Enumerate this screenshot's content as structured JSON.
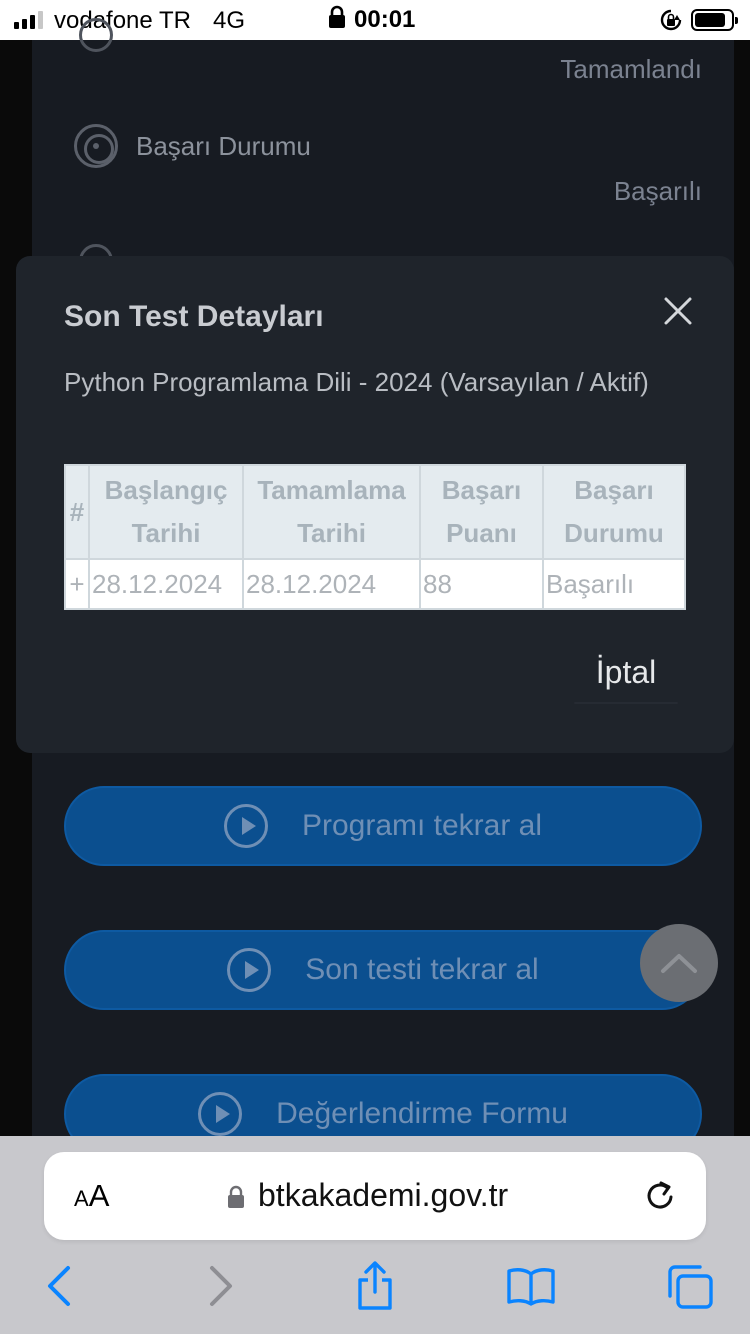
{
  "status_bar": {
    "carrier": "vodafone TR",
    "network": "4G",
    "time": "00:01",
    "battery_level": 0.85
  },
  "background": {
    "rows": [
      {
        "label": "",
        "value": "Tamamlandı"
      },
      {
        "label": "Başarı Durumu",
        "value": "Başarılı"
      }
    ],
    "buttons": [
      {
        "label": "Programı tekrar al"
      },
      {
        "label": "Son testi tekrar al"
      },
      {
        "label": "Değerlendirme Formu"
      }
    ]
  },
  "modal": {
    "title": "Son Test Detayları",
    "subtitle": "Python Programlama Dili - 2024 (Varsayılan / Aktif)",
    "table": {
      "headers": [
        "#",
        "Başlangıç Tarihi",
        "Tamamlama Tarihi",
        "Başarı Puanı",
        "Başarı Durumu"
      ],
      "rows": [
        [
          "+",
          "28.12.2024",
          "28.12.2024",
          "88",
          "Başarılı"
        ]
      ]
    },
    "cancel_label": "İptal"
  },
  "browser": {
    "text_size_small": "A",
    "text_size_large": "A",
    "url": "btkakademi.gov.tr"
  },
  "icons": {
    "close": "close-icon",
    "play": "play-circle-icon",
    "scroll_top": "chevron-up-icon",
    "back": "chevron-left-icon",
    "forward": "chevron-right-icon",
    "share": "share-icon",
    "bookmarks": "book-icon",
    "tabs": "tabs-icon"
  },
  "colors": {
    "primary_button": "#0b4f8f",
    "modal_background": "#1f242b",
    "ios_blue": "#0a84ff"
  }
}
